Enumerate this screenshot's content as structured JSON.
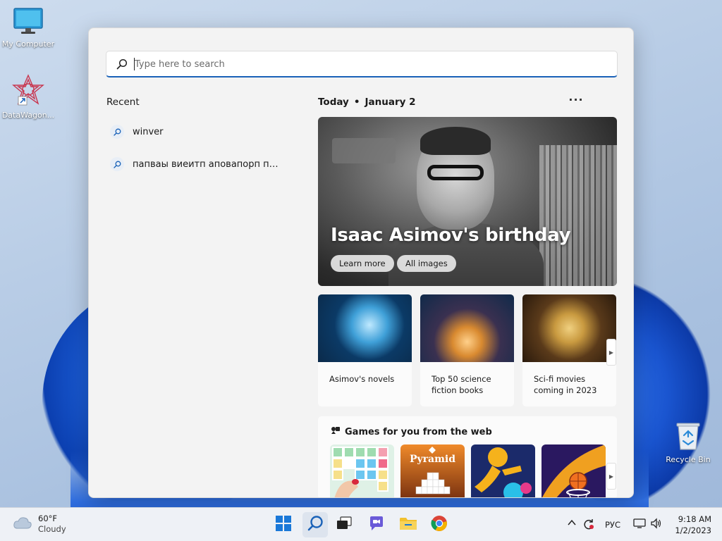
{
  "desktop": {
    "icons": [
      {
        "label": "My Computer",
        "icon": "monitor-icon"
      },
      {
        "label": "DataWagon...",
        "icon": "datawagon-icon"
      },
      {
        "label": "Recycle Bin",
        "icon": "recycle-bin-icon"
      }
    ]
  },
  "search": {
    "placeholder": "Type here to search",
    "value": ""
  },
  "recent": {
    "title": "Recent",
    "items": [
      {
        "label": "winver",
        "icon": "search-icon"
      },
      {
        "label": "папвaы виеитп аповапорп пш...",
        "icon": "search-icon"
      }
    ]
  },
  "highlights": {
    "today_label": "Today",
    "date": "January 2",
    "more_label": "···",
    "hero": {
      "title": "Isaac Asimov's birthday",
      "buttons": [
        "Learn more",
        "All images"
      ]
    },
    "cards": [
      {
        "label": "Asimov's novels",
        "colors": [
          "#0b2a4a",
          "#3fa0d8"
        ]
      },
      {
        "label": "Top 50 science fiction books",
        "colors": [
          "#102a4a",
          "#d98a30"
        ]
      },
      {
        "label": "Sci-fi movies coming in 2023",
        "colors": [
          "#2a1a0c",
          "#c99a40"
        ]
      }
    ],
    "next_icon": "chevron-right-icon"
  },
  "games": {
    "title": "Games for you from the web",
    "items": [
      {
        "name": "block-puzzle",
        "colors": [
          "#cfe8d8",
          "#7ad0f0"
        ],
        "label": ""
      },
      {
        "name": "pyramid",
        "colors": [
          "#e8731c",
          "#7a3210"
        ],
        "label": "Pyramid"
      },
      {
        "name": "runner",
        "colors": [
          "#1b2a6a",
          "#f5b21c"
        ],
        "label": ""
      },
      {
        "name": "basketball",
        "colors": [
          "#2a1860",
          "#f07020"
        ],
        "label": ""
      }
    ]
  },
  "taskbar": {
    "weather": {
      "temp": "60°F",
      "condition": "Cloudy"
    },
    "apps": [
      {
        "name": "start-button",
        "icon": "windows-logo-icon",
        "active": false
      },
      {
        "name": "search-button",
        "icon": "search-icon",
        "active": true
      },
      {
        "name": "task-view-button",
        "icon": "task-view-icon",
        "active": false
      },
      {
        "name": "chat-button",
        "icon": "chat-icon",
        "active": false
      },
      {
        "name": "file-explorer-button",
        "icon": "folder-icon",
        "active": false
      },
      {
        "name": "chrome-button",
        "icon": "chrome-icon",
        "active": false
      }
    ],
    "tray": {
      "language": "РУС",
      "time": "9:18 AM",
      "date": "1/2/2023"
    }
  },
  "colors": {
    "accent": "#1a62b8",
    "panel_bg": "#f3f3f3",
    "taskbar_bg": "#eef1f6"
  }
}
